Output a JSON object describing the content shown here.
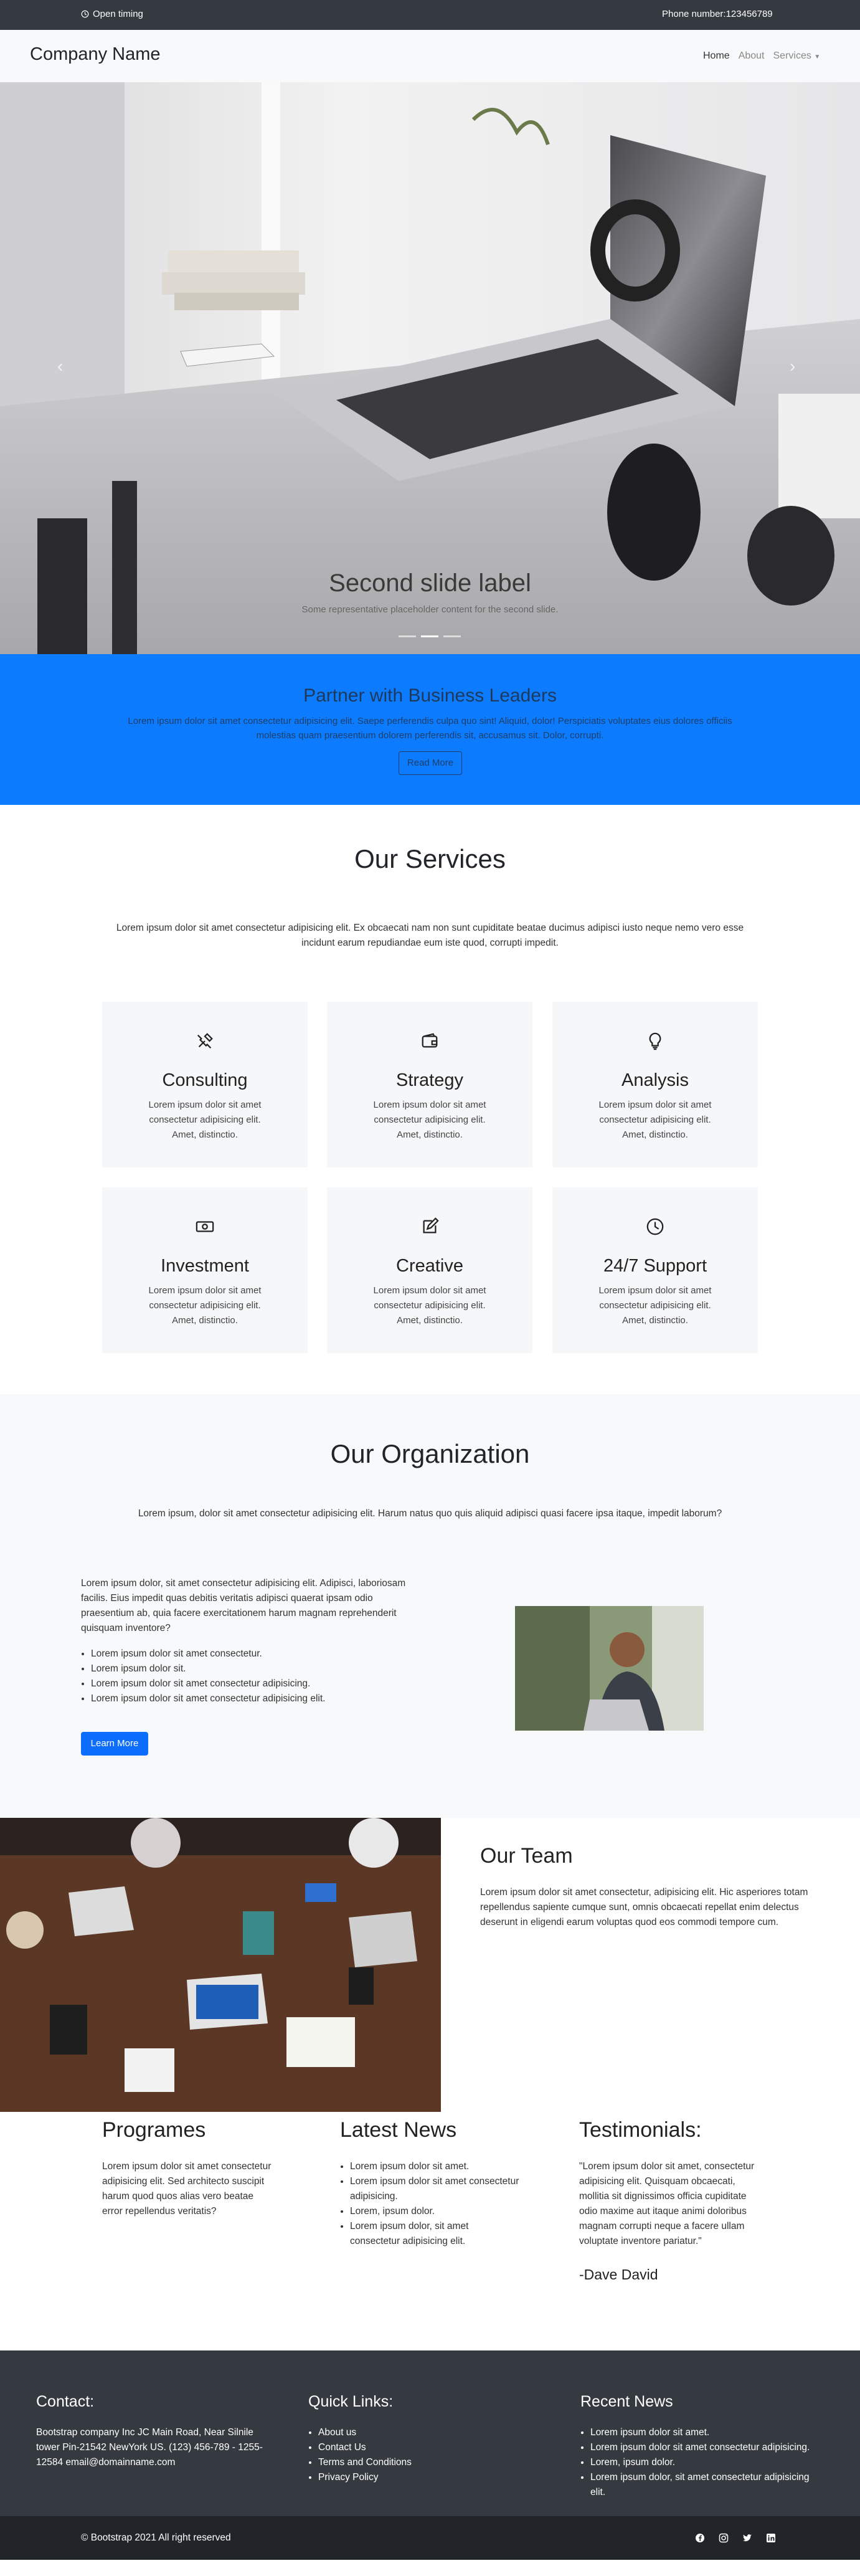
{
  "topbar": {
    "open_timing": "Open timing",
    "phone": "Phone number:123456789"
  },
  "navbar": {
    "brand": "Company Name",
    "links": [
      "Home",
      "About",
      "Services"
    ]
  },
  "hero": {
    "caption_title": "Second slide label",
    "caption_text": "Some representative placeholder content for the second slide.",
    "slides": 3,
    "active_slide": 2
  },
  "partner": {
    "title": "Partner with Business Leaders",
    "text": "Lorem ipsum dolor sit amet consectetur adipisicing elit. Saepe perferendis culpa quo sint! Aliquid, dolor! Perspiciatis voluptates eius dolores officiis molestias quam praesentium dolorem perferendis sit, accusamus sit. Dolor, corrupti.",
    "button": "Read More"
  },
  "services": {
    "title": "Our Services",
    "lead": "Lorem ipsum dolor sit amet consectetur adipisicing elit. Ex obcaecati nam non sunt cupiditate beatae ducimus adipisci iusto neque nemo vero esse incidunt earum repudiandae eum iste quod, corrupti impedit.",
    "cards": [
      {
        "icon": "tools-icon",
        "title": "Consulting",
        "text": "Lorem ipsum dolor sit amet consectetur adipisicing elit. Amet, distinctio."
      },
      {
        "icon": "wallet-icon",
        "title": "Strategy",
        "text": "Lorem ipsum dolor sit amet consectetur adipisicing elit. Amet, distinctio."
      },
      {
        "icon": "lightbulb-icon",
        "title": "Analysis",
        "text": "Lorem ipsum dolor sit amet consectetur adipisicing elit. Amet, distinctio."
      },
      {
        "icon": "cash-icon",
        "title": "Investment",
        "text": "Lorem ipsum dolor sit amet consectetur adipisicing elit. Amet, distinctio."
      },
      {
        "icon": "pencil-square-icon",
        "title": "Creative",
        "text": "Lorem ipsum dolor sit amet consectetur adipisicing elit. Amet, distinctio."
      },
      {
        "icon": "clock-icon",
        "title": "24/7 Support",
        "text": "Lorem ipsum dolor sit amet consectetur adipisicing elit. Amet, distinctio."
      }
    ]
  },
  "organization": {
    "title": "Our Organization",
    "lead": "Lorem ipsum, dolor sit amet consectetur adipisicing elit. Harum natus quo quis aliquid adipisci quasi facere ipsa itaque, impedit laborum?",
    "text": "Lorem ipsum dolor, sit amet consectetur adipisicing elit. Adipisci, laboriosam facilis. Eius impedit quas debitis veritatis adipisci quaerat ipsam odio praesentium ab, quia facere exercitationem harum magnam reprehenderit quisquam inventore?",
    "bullets": [
      "Lorem ipsum dolor sit amet consectetur.",
      "Lorem ipsum dolor sit.",
      "Lorem ipsum dolor sit amet consectetur adipisicing.",
      "Lorem ipsum dolor sit amet consectetur adipisicing elit."
    ],
    "button": "Learn More"
  },
  "team": {
    "title": "Our Team",
    "text": "Lorem ipsum dolor sit amet consectetur, adipisicing elit. Hic asperiores totam repellendus sapiente cumque sunt, omnis obcaecati repellat enim delectus deserunt in eligendi earum voluptas quod eos commodi tempore cum."
  },
  "programes": {
    "title": "Programes",
    "text": "Lorem ipsum dolor sit amet consectetur adipisicing elit. Sed architecto suscipit harum quod quos alias vero beatae error repellendus veritatis?"
  },
  "news": {
    "title": "Latest News",
    "items": [
      "Lorem ipsum dolor sit amet.",
      "Lorem ipsum dolor sit amet consectetur adipisicing.",
      "Lorem, ipsum dolor.",
      "Lorem ipsum dolor, sit amet consectetur adipisicing elit."
    ]
  },
  "testimonials": {
    "title": "Testimonials:",
    "quote": "\"Lorem ipsum dolor sit amet, consectetur adipisicing elit. Quisquam obcaecati, mollitia sit dignissimos officia cupiditate odio maxime aut itaque animi doloribus magnam corrupti neque a facere ullam voluptate inventore pariatur.\"",
    "author": "-Dave David"
  },
  "footer": {
    "contact_title": "Contact:",
    "contact_text": "Bootstrap company Inc JC Main Road, Near Silnile tower Pin-21542 NewYork US. (123) 456-789 - 1255-12584 email@domainname.com",
    "quick_title": "Quick Links:",
    "quick_links": [
      "About us",
      "Contact Us",
      "Terms and Conditions",
      "Privacy Policy"
    ],
    "recent_title": "Recent News",
    "recent_items": [
      "Lorem ipsum dolor sit amet.",
      "Lorem ipsum dolor sit amet consectetur adipisicing.",
      "Lorem, ipsum dolor.",
      "Lorem ipsum dolor, sit amet consectetur adipisicing elit."
    ],
    "copyright": "© Bootstrap 2021 All right reserved",
    "social_icons": [
      "facebook-icon",
      "instagram-icon",
      "twitter-icon",
      "linkedin-icon"
    ]
  }
}
